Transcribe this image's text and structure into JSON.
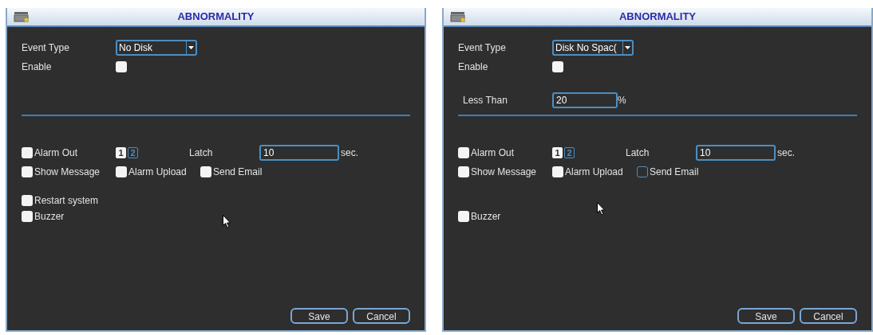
{
  "panels": [
    {
      "title": "ABNORMALITY",
      "event_type": {
        "label": "Event Type",
        "value": "No Disk"
      },
      "enable": {
        "label": "Enable",
        "checked": false
      },
      "alarm_out": {
        "label": "Alarm Out",
        "checked": false,
        "channels": [
          {
            "label": "1",
            "selected": true
          },
          {
            "label": "2",
            "selected": false
          }
        ]
      },
      "latch": {
        "label": "Latch",
        "value": "10",
        "unit": "sec."
      },
      "options": [
        {
          "label": "Show Message",
          "checked": false
        },
        {
          "label": "Alarm Upload",
          "checked": false
        },
        {
          "label": "Send Email",
          "checked": false
        }
      ],
      "lower_options": [
        {
          "label": "Restart system",
          "checked": false
        },
        {
          "label": "Buzzer",
          "checked": false
        }
      ],
      "buttons": [
        "Save",
        "Cancel"
      ]
    },
    {
      "title": "ABNORMALITY",
      "event_type": {
        "label": "Event Type",
        "value": "Disk No Spac("
      },
      "enable": {
        "label": "Enable",
        "checked": false
      },
      "threshold": {
        "label": "Less Than",
        "value": "20",
        "unit": "%"
      },
      "alarm_out": {
        "label": "Alarm Out",
        "checked": false,
        "channels": [
          {
            "label": "1",
            "selected": true
          },
          {
            "label": "2",
            "selected": false
          }
        ]
      },
      "latch": {
        "label": "Latch",
        "value": "10",
        "unit": "sec."
      },
      "options": [
        {
          "label": "Show Message",
          "checked": false,
          "kind": "filled"
        },
        {
          "label": "Alarm Upload",
          "checked": false,
          "kind": "filled"
        },
        {
          "label": "Send Email",
          "checked": false,
          "kind": "outlined"
        }
      ],
      "lower_options": [
        {
          "label": "Buzzer",
          "checked": false
        }
      ],
      "buttons": [
        "Save",
        "Cancel"
      ]
    }
  ]
}
